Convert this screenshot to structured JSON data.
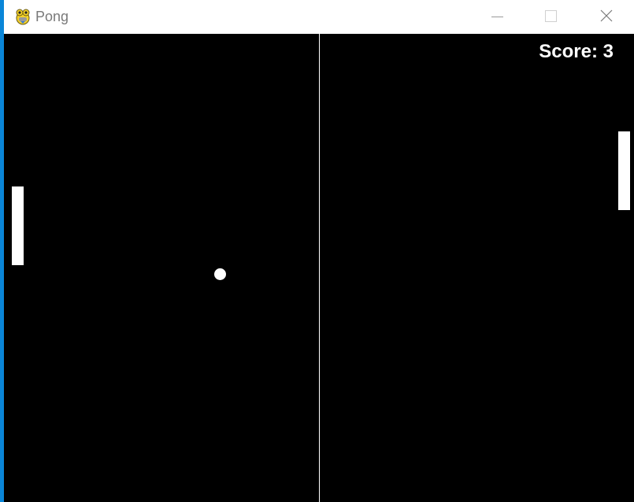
{
  "window": {
    "title": "Pong",
    "icon": "pygame-snake-icon",
    "controls": {
      "minimize_icon": "minimize-icon",
      "maximize_icon": "maximize-icon",
      "close_icon": "close-icon"
    }
  },
  "game": {
    "score_text": "Score: 3",
    "background_color": "#000000",
    "foreground_color": "#ffffff"
  }
}
